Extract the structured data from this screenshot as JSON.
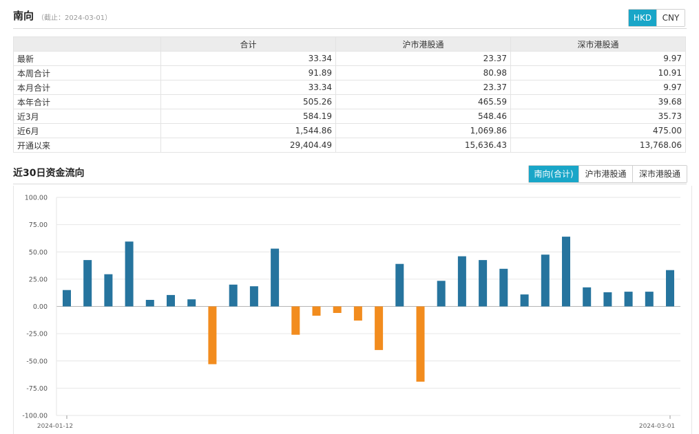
{
  "header": {
    "title": "南向",
    "date_note": "（截止：2024-03-01）",
    "currency_options": [
      "HKD",
      "CNY"
    ],
    "currency_selected": "HKD"
  },
  "summary_table": {
    "columns": [
      "合计",
      "沪市港股通",
      "深市港股通"
    ],
    "rows": [
      {
        "label": "最新",
        "values": [
          "33.34",
          "23.37",
          "9.97"
        ]
      },
      {
        "label": "本周合计",
        "values": [
          "91.89",
          "80.98",
          "10.91"
        ]
      },
      {
        "label": "本月合计",
        "values": [
          "33.34",
          "23.37",
          "9.97"
        ]
      },
      {
        "label": "本年合计",
        "values": [
          "505.26",
          "465.59",
          "39.68"
        ]
      },
      {
        "label": "近3月",
        "values": [
          "584.19",
          "548.46",
          "35.73"
        ]
      },
      {
        "label": "近6月",
        "values": [
          "1,544.86",
          "1,069.86",
          "475.00"
        ]
      },
      {
        "label": "开通以来",
        "values": [
          "29,404.49",
          "15,636.43",
          "13,768.06"
        ]
      }
    ]
  },
  "flow_section": {
    "title": "近30日资金流向",
    "tabs": [
      "南向(合计)",
      "沪市港股通",
      "深市港股通"
    ],
    "active_tab": "南向(合计)"
  },
  "colors": {
    "accent": "#19a6c8",
    "bar_positive": "#26749e",
    "bar_negative": "#f28c1e",
    "grid": "#e6e6e6"
  },
  "chart_data": {
    "type": "bar",
    "x_first_label": "2024-01-12",
    "x_last_label": "2024-03-01",
    "ylim": [
      -100,
      100
    ],
    "yticks": [
      "100.00",
      "75.00",
      "50.00",
      "25.00",
      "0.00",
      "-25.00",
      "-50.00",
      "-75.00",
      "-100.00"
    ],
    "values": [
      15,
      42.5,
      29.5,
      59.5,
      6,
      10.5,
      6.5,
      -53,
      20,
      18.5,
      53,
      -26,
      -8.5,
      -6,
      -13,
      -40,
      39,
      -69,
      23.5,
      46,
      42.5,
      34.5,
      11,
      47.5,
      64,
      17.5,
      13,
      13.5,
      13.5,
      33.34
    ],
    "grid": true
  }
}
